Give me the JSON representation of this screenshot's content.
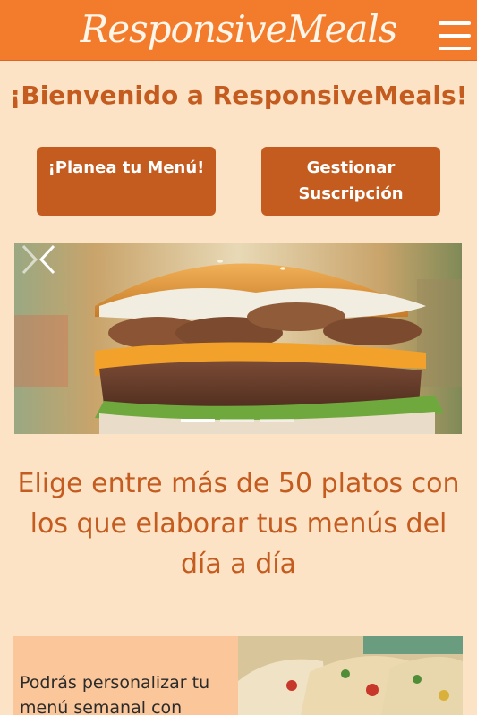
{
  "navbar": {
    "brand": "ResponsiveMeals",
    "menu_icon": "hamburger-icon"
  },
  "hero": {
    "welcome": "¡Bienvenido a ResponsiveMeals!"
  },
  "actions": {
    "plan_label": "¡Planea tu Menú!",
    "subscription_label": "Gestionar Suscripción"
  },
  "carousel": {
    "slide_image": "burger-photo",
    "prev_icon": "chevron-left-icon",
    "next_icon": "chevron-right-icon",
    "active_index": 1,
    "slide_count": 3
  },
  "tagline": "Elige entre más de 50 platos con los que elaborar tus menús del día a día",
  "feature": {
    "text": "Podrás personalizar tu menú semanal con",
    "image": "tacos-photo"
  },
  "colors": {
    "nav_bg": "#f37c2c",
    "page_bg": "#fde3c6",
    "accent": "#c45b1f",
    "feature_bg": "#fbc79a"
  }
}
